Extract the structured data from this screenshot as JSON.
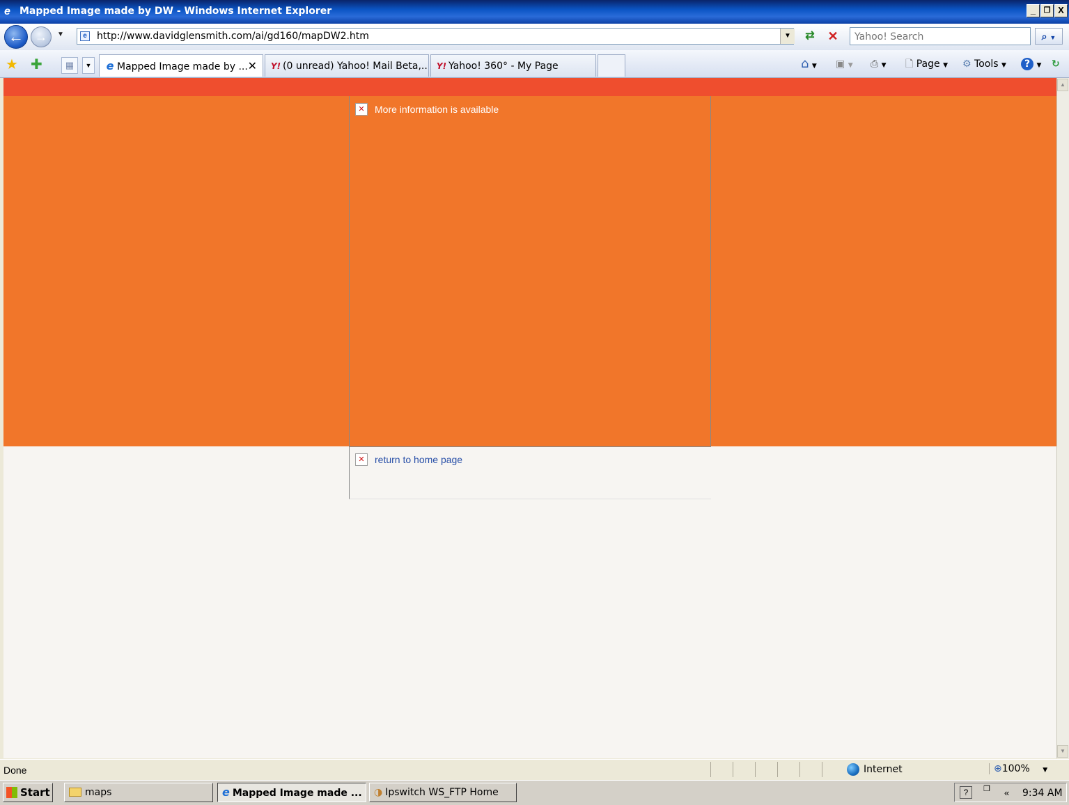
{
  "window": {
    "title": "Mapped Image made by DW - Windows Internet Explorer",
    "minimize": "_",
    "restore": "̅❐",
    "close": "X"
  },
  "address": {
    "url": "http://www.davidglensmith.com/ai/gd160/mapDW2.htm",
    "search_placeholder": "Yahoo! Search"
  },
  "tabs": [
    {
      "label": "Mapped Image made by ...",
      "icon": "ie-icon",
      "active": true
    },
    {
      "label": "(0 unread) Yahoo! Mail Beta,...",
      "icon": "yahoo-icon",
      "active": false
    },
    {
      "label": "Yahoo! 360° - My Page",
      "icon": "yahoo-icon",
      "active": false
    }
  ],
  "commandbar": {
    "page": "Page",
    "tools": "Tools"
  },
  "content": {
    "map_alt": "More information is available",
    "home_link": "return to home page",
    "colors": {
      "top_strip": "#ef4e2e",
      "band": "#f1762a",
      "background": "#f7f5f2"
    }
  },
  "status": {
    "text": "Done",
    "zone": "Internet",
    "zoom": "100%"
  },
  "taskbar": {
    "start": "Start",
    "items": [
      {
        "label": "maps",
        "pressed": false
      },
      {
        "label": "Mapped Image made ...",
        "pressed": true
      },
      {
        "label": "Ipswitch WS_FTP Home",
        "pressed": false
      }
    ],
    "clock": "9:34 AM"
  }
}
